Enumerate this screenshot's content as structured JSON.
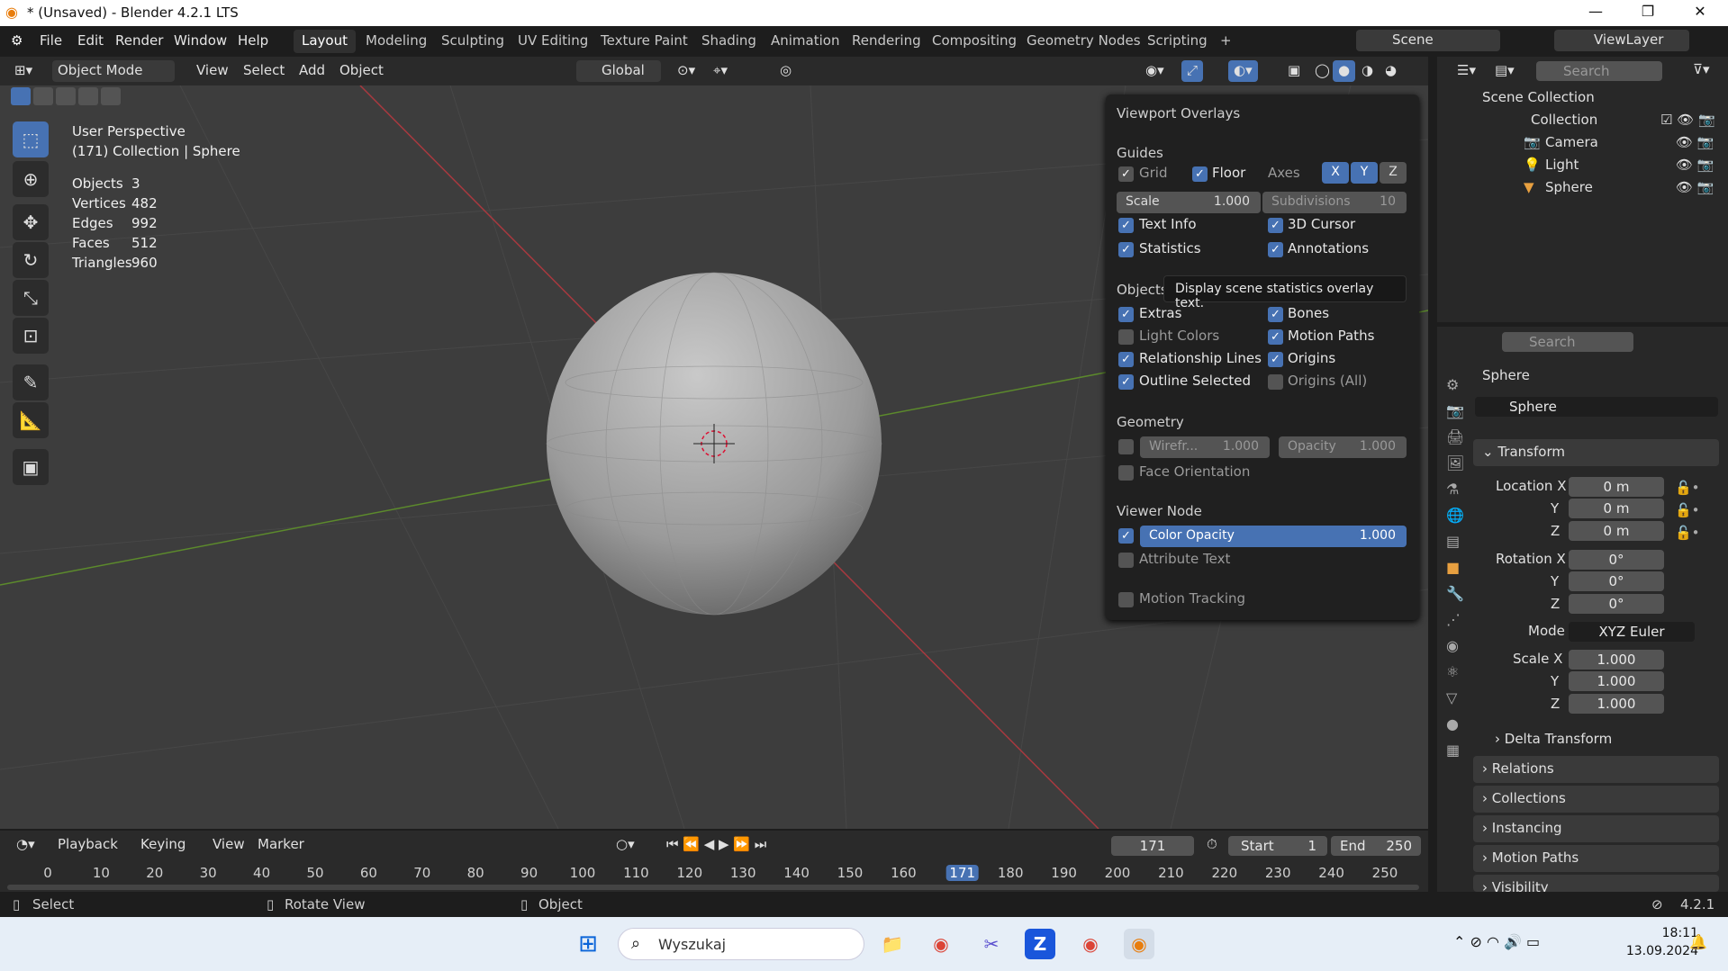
{
  "window": {
    "title": "* (Unsaved) - Blender 4.2.1 LTS",
    "min": "—",
    "max": "❐",
    "close": "✕"
  },
  "menus": [
    "File",
    "Edit",
    "Render",
    "Window",
    "Help"
  ],
  "workspaces": [
    "Layout",
    "Modeling",
    "Sculpting",
    "UV Editing",
    "Texture Paint",
    "Shading",
    "Animation",
    "Rendering",
    "Compositing",
    "Geometry Nodes",
    "Scripting"
  ],
  "add_workspace": "+",
  "scene": "Scene",
  "view_layer": "ViewLayer",
  "viewport_header": {
    "mode": "Object Mode",
    "view": "View",
    "select": "Select",
    "add": "Add",
    "object": "Object",
    "transform": "Global"
  },
  "viewport_info": {
    "perspective": "User Perspective",
    "collection": "(171) Collection | Sphere",
    "stats": [
      {
        "k": "Objects",
        "v": "3"
      },
      {
        "k": "Vertices",
        "v": "482"
      },
      {
        "k": "Edges",
        "v": "992"
      },
      {
        "k": "Faces",
        "v": "512"
      },
      {
        "k": "Triangles",
        "v": "960"
      }
    ]
  },
  "overlays": {
    "title": "Viewport Overlays",
    "guides": "Guides",
    "grid": "Grid",
    "floor": "Floor",
    "axes": "Axes",
    "x": "X",
    "y": "Y",
    "z": "Z",
    "scale_label": "Scale",
    "scale_value": "1.000",
    "subdiv_label": "Subdivisions",
    "subdiv_value": "10",
    "text_info": "Text Info",
    "cursor3d": "3D Cursor",
    "statistics": "Statistics",
    "annotations": "Annotations",
    "objects": "Objects",
    "extras": "Extras",
    "bones": "Bones",
    "light_colors": "Light Colors",
    "motion_paths": "Motion Paths",
    "relationship_lines": "Relationship Lines",
    "origins": "Origins",
    "outline_selected": "Outline Selected",
    "origins_all": "Origins (All)",
    "geometry": "Geometry",
    "wireframe_label": "Wirefr...",
    "wireframe_value": "1.000",
    "opacity_label": "Opacity",
    "opacity_value": "1.000",
    "face_orientation": "Face Orientation",
    "viewer_node": "Viewer Node",
    "color_opacity_label": "Color Opacity",
    "color_opacity_value": "1.000",
    "attribute_text": "Attribute Text",
    "motion_tracking": "Motion Tracking"
  },
  "tooltip": "Display scene statistics overlay text.",
  "outliner": {
    "search": "Search",
    "scene_collection": "Scene Collection",
    "collection": "Collection",
    "items": [
      "Camera",
      "Light",
      "Sphere"
    ]
  },
  "properties": {
    "search": "Search",
    "object_name": "Sphere",
    "data_name": "Sphere",
    "transform": "Transform",
    "location_x": "Location X",
    "rotation_x": "Rotation X",
    "scale_x": "Scale X",
    "y": "Y",
    "z": "Z",
    "mode_label": "Mode",
    "loc": [
      "0 m",
      "0 m",
      "0 m"
    ],
    "rot": [
      "0°",
      "0°",
      "0°"
    ],
    "scale": [
      "1.000",
      "1.000",
      "1.000"
    ],
    "mode": "XYZ Euler",
    "delta": "Delta Transform",
    "panels": [
      "Relations",
      "Collections",
      "Instancing",
      "Motion Paths",
      "Visibility"
    ]
  },
  "timeline": {
    "playback": "Playback",
    "keying": "Keying",
    "view": "View",
    "marker": "Marker",
    "current": "171",
    "start_label": "Start",
    "start": "1",
    "end_label": "End",
    "end": "250",
    "ticks": [
      "0",
      "10",
      "20",
      "30",
      "40",
      "50",
      "60",
      "70",
      "80",
      "90",
      "100",
      "110",
      "120",
      "130",
      "140",
      "150",
      "160",
      "171",
      "180",
      "190",
      "200",
      "210",
      "220",
      "230",
      "240",
      "250"
    ]
  },
  "status": {
    "select": "Select",
    "rotate": "Rotate View",
    "object": "Object",
    "version": "4.2.1"
  },
  "taskbar": {
    "search": "Wyszukaj",
    "time": "18:11",
    "date": "13.09.2024"
  }
}
